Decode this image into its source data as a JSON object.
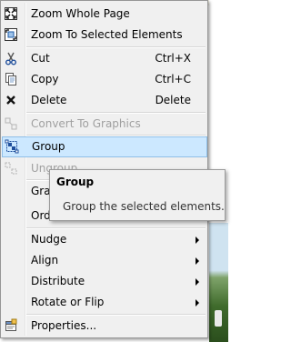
{
  "menu": {
    "items": [
      {
        "label": "Zoom Whole Page",
        "shortcut": "",
        "icon": "zoom-whole-page-icon"
      },
      {
        "label": "Zoom To Selected Elements",
        "shortcut": "",
        "icon": "zoom-selected-icon"
      },
      {
        "label": "Cut",
        "shortcut": "Ctrl+X",
        "icon": "scissors-icon"
      },
      {
        "label": "Copy",
        "shortcut": "Ctrl+C",
        "icon": "copy-icon"
      },
      {
        "label": "Delete",
        "shortcut": "Delete",
        "icon": "delete-x-icon"
      },
      {
        "label": "Convert To Graphics",
        "shortcut": "",
        "icon": "convert-graphics-icon"
      },
      {
        "label": "Group",
        "shortcut": "",
        "icon": "group-icon"
      },
      {
        "label": "Ungroup",
        "shortcut": "",
        "icon": "ungroup-icon"
      },
      {
        "label": "Grap",
        "shortcut": "",
        "icon": ""
      },
      {
        "label": "Ord",
        "shortcut": "",
        "icon": ""
      },
      {
        "label": "Nudge",
        "shortcut": "",
        "icon": ""
      },
      {
        "label": "Align",
        "shortcut": "",
        "icon": ""
      },
      {
        "label": "Distribute",
        "shortcut": "",
        "icon": ""
      },
      {
        "label": "Rotate or Flip",
        "shortcut": "",
        "icon": ""
      },
      {
        "label": "Properties...",
        "shortcut": "",
        "icon": "properties-icon"
      }
    ]
  },
  "tooltip": {
    "title": "Group",
    "description": "Group the selected elements."
  },
  "colors": {
    "highlight": "#cce8ff",
    "highlight_border": "#8fbfe8",
    "disabled_text": "#a0a0a0",
    "menu_bg": "#f0f0f0"
  }
}
